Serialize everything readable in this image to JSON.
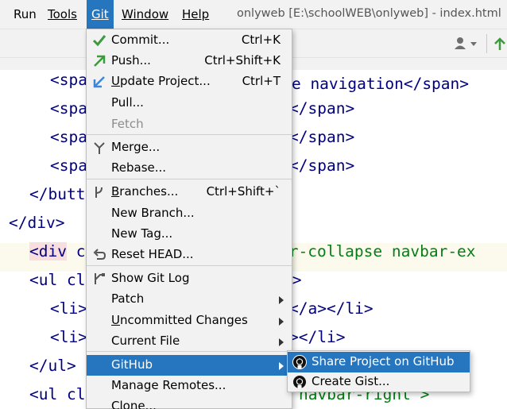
{
  "menubar": {
    "run": "Run",
    "tools": "Tools",
    "git": "Git",
    "window": "Window",
    "help": "Help",
    "window_title": "onlyweb [E:\\schoolWEB\\onlyweb] - index.html"
  },
  "editor": {
    "lines": [
      {
        "indent": "    ",
        "text": "<spa",
        "rest": ""
      },
      {
        "indent": "    ",
        "text": "<spa",
        "rest": "</span>"
      },
      {
        "indent": "    ",
        "text": "<spa",
        "rest": "</span>"
      },
      {
        "indent": "    ",
        "text": "<spa",
        "rest": "</span>"
      },
      {
        "indent": "  ",
        "text": "</butt",
        "rest": ""
      },
      {
        "indent": "",
        "text": "</div>",
        "rest": ""
      },
      {
        "indent": "  ",
        "text": "<div c",
        "rest": "ar-collapse navbar-ex"
      },
      {
        "indent": "  ",
        "text": "<ul cl",
        "rest": "\">"
      },
      {
        "indent": "    ",
        "text": "<li>",
        "rest": "</a></li>"
      },
      {
        "indent": "    ",
        "text": "<li>",
        "rest": "></li>"
      },
      {
        "indent": "  ",
        "text": "</ul>",
        "rest": ""
      },
      {
        "indent": "  ",
        "text": "<ul cl",
        "rest": "navbar-right\">"
      },
      {
        "indent": "    ",
        "text": "",
        "rest": ""
      }
    ],
    "ghost_text": "oggle navigation</span>"
  },
  "git_menu": {
    "items": [
      {
        "label_u": "",
        "label_rest": "Commit...",
        "underline": "",
        "shortcut": "Ctrl+K",
        "icon": "check-icon"
      },
      {
        "label_u": "",
        "label_rest": "Push...",
        "shortcut": "Ctrl+Shift+K",
        "icon": "push-arrow-icon"
      },
      {
        "label_u": "U",
        "label_rest": "pdate Project...",
        "shortcut": "Ctrl+T",
        "icon": "update-arrow-icon"
      },
      {
        "label_u": "",
        "label_rest": "Pull...",
        "shortcut": "",
        "icon": ""
      },
      {
        "label_u": "",
        "label_rest": "Fetch",
        "shortcut": "",
        "icon": "",
        "disabled": true
      },
      {
        "label_u": "",
        "label_rest": "Merge...",
        "shortcut": "",
        "icon": "merge-icon"
      },
      {
        "label_u": "",
        "label_rest": "Rebase...",
        "shortcut": "",
        "icon": ""
      },
      {
        "label_u": "B",
        "label_rest": "ranches...",
        "shortcut": "Ctrl+Shift+`",
        "icon": "branch-icon"
      },
      {
        "label_u": "",
        "label_rest": "New Branch...",
        "shortcut": "",
        "icon": ""
      },
      {
        "label_u": "",
        "label_rest": "New Tag...",
        "shortcut": "",
        "icon": ""
      },
      {
        "label_u": "",
        "label_rest": "Reset HEAD...",
        "shortcut": "",
        "icon": "reset-icon"
      },
      {
        "label_u": "",
        "label_rest": "Show Git Log",
        "shortcut": "",
        "icon": "git-log-icon"
      },
      {
        "label_u": "",
        "label_rest": "Patch",
        "shortcut": "",
        "icon": "",
        "submenu": true
      },
      {
        "label_u": "U",
        "label_rest": "ncommitted Changes",
        "shortcut": "",
        "icon": "",
        "submenu": true
      },
      {
        "label_u": "",
        "label_rest": "Current File",
        "shortcut": "",
        "icon": "",
        "submenu": true
      },
      {
        "label_u": "",
        "label_rest": "GitHub",
        "shortcut": "",
        "icon": "",
        "submenu": true,
        "selected": true
      },
      {
        "label_u": "",
        "label_rest": "Manage Remotes...",
        "shortcut": "",
        "icon": ""
      },
      {
        "label_u": "",
        "label_rest": "Clone...",
        "shortcut": "",
        "icon": ""
      }
    ]
  },
  "github_submenu": {
    "items": [
      {
        "label": "Share Project on GitHub",
        "icon": "github-icon"
      },
      {
        "label": "Create Gist...",
        "icon": "github-icon"
      }
    ]
  },
  "colors": {
    "accent": "#2675bf",
    "menu_bg": "#f2f2f2",
    "check_green": "#3d9a3d",
    "push_green": "#3d9a3d",
    "update_blue": "#3d87d6",
    "code_tag": "#000080",
    "code_attr": "#067d17"
  }
}
